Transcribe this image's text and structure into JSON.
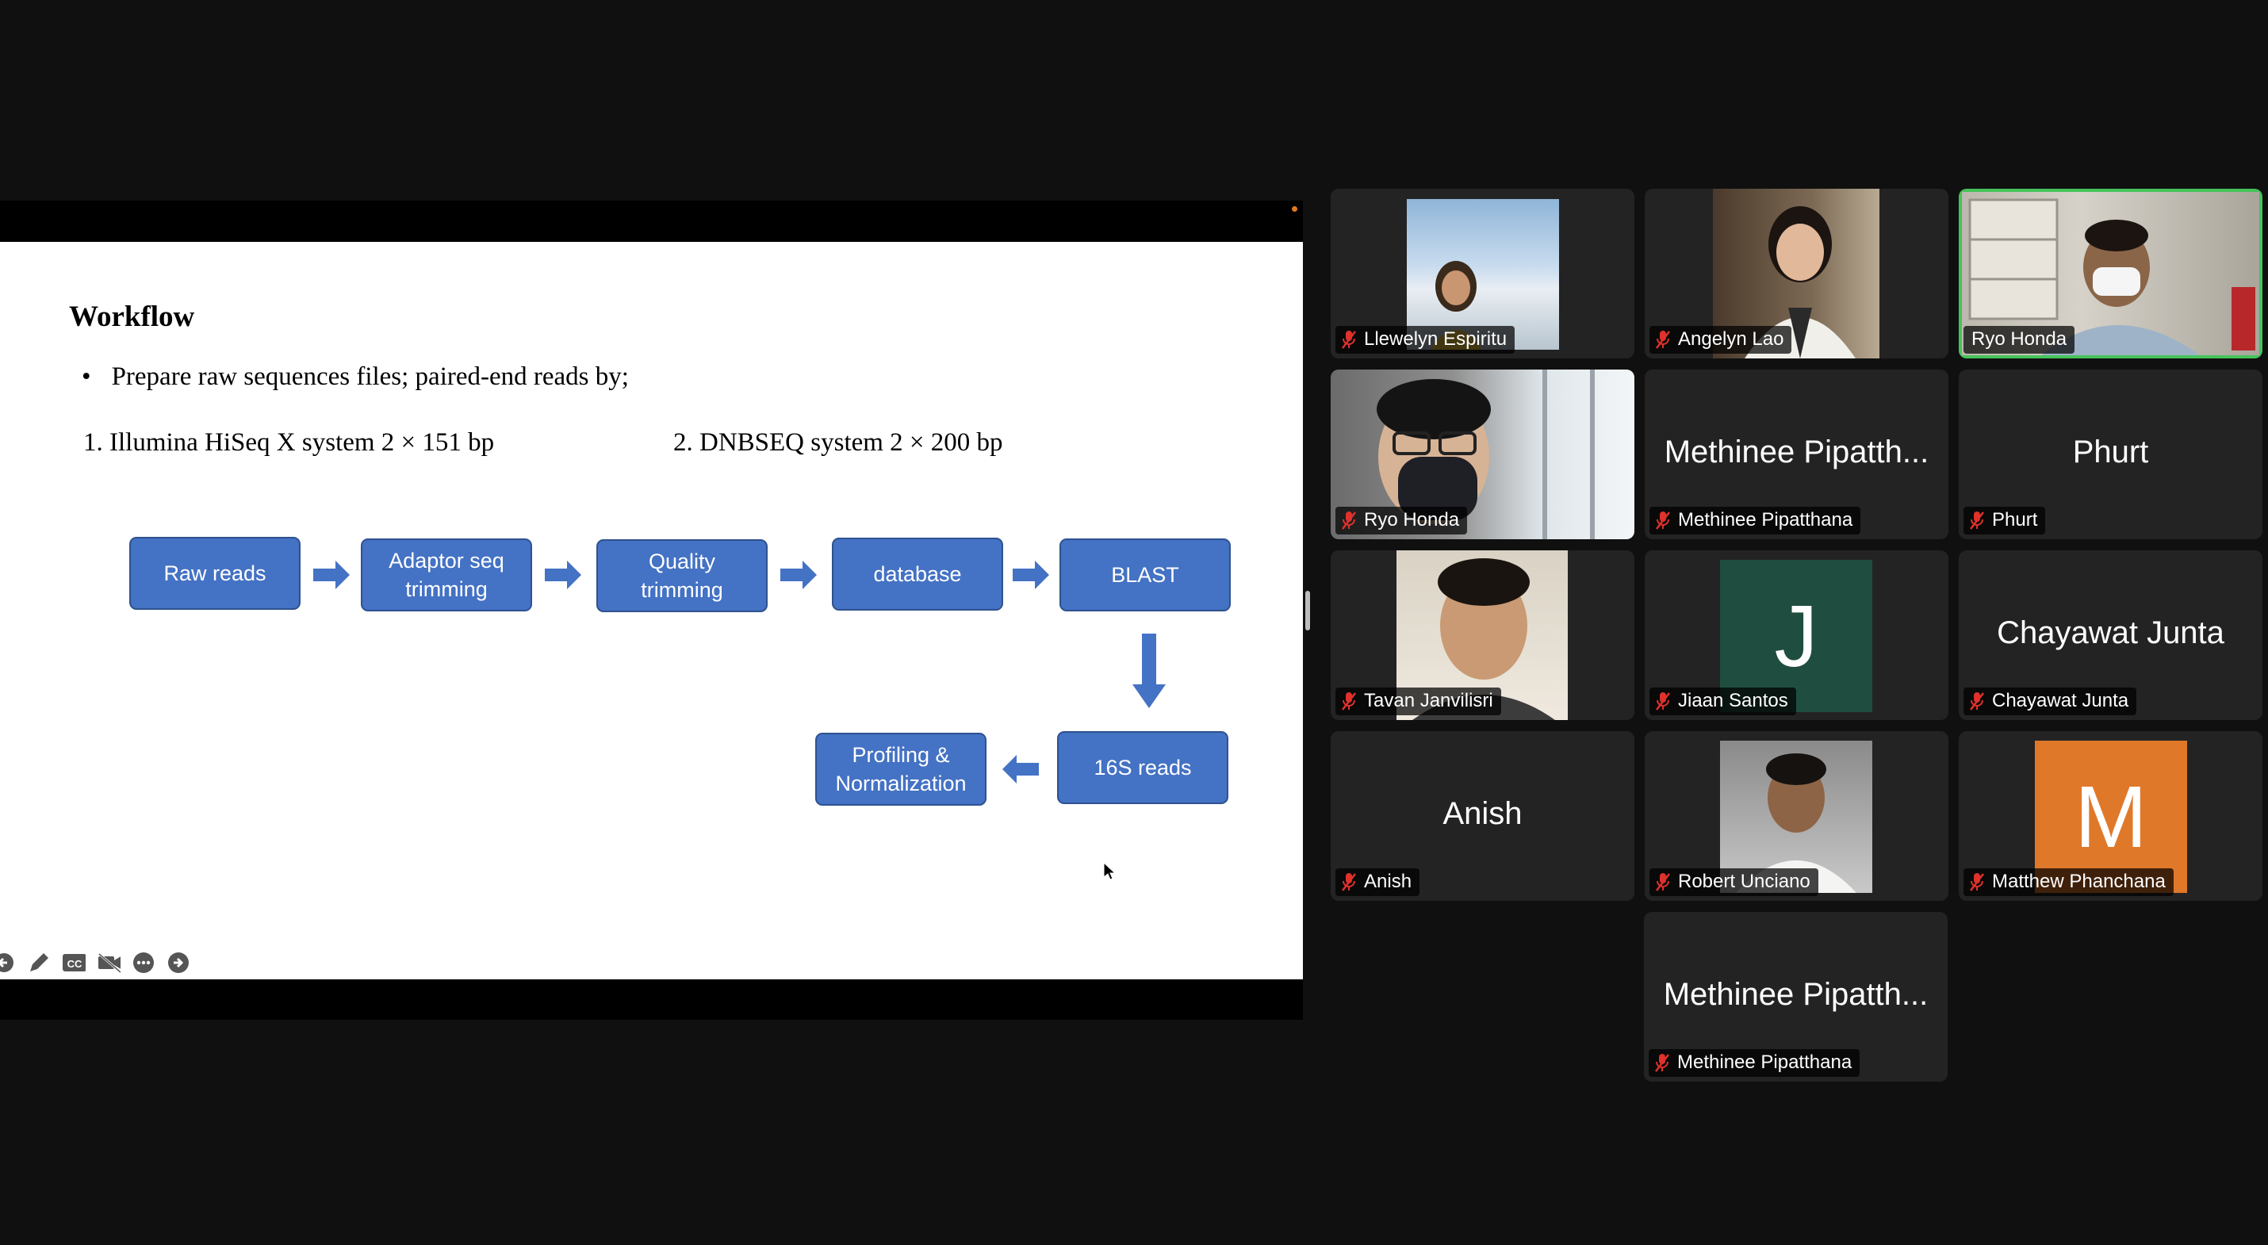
{
  "slide": {
    "title": "Workflow",
    "bullet": "Prepare raw sequences files; paired-end reads by;",
    "item1": "1. Illumina HiSeq X system 2 × 151 bp",
    "item2": "2. DNBSEQ system 2 × 200 bp",
    "flow": {
      "raw_reads": "Raw reads",
      "adaptor_l1": "Adaptor seq",
      "adaptor_l2": "trimming",
      "quality_l1": "Quality",
      "quality_l2": "trimming",
      "database": "database",
      "blast": "BLAST",
      "reads16s": "16S reads",
      "profiling_l1": "Profiling &",
      "profiling_l2": "Normalization"
    },
    "box_color": "#4472c4",
    "toolbar_icons": [
      "arrow-left-icon",
      "pen-icon",
      "captions-icon",
      "video-off-icon",
      "more-icon",
      "arrow-right-icon"
    ]
  },
  "participants": [
    {
      "name": "Llewelyn Espiritu",
      "muted": true,
      "video": "photo"
    },
    {
      "name": "Angelyn Lao",
      "muted": true,
      "video": "photo"
    },
    {
      "name": "Ryo Honda",
      "muted": false,
      "video": "photo",
      "active_speaker": true
    },
    {
      "name": "Ryo Honda",
      "muted": true,
      "video": "photo"
    },
    {
      "name": "Methinee Pipatthana",
      "display": "Methinee Pipatth...",
      "muted": true,
      "video": "off"
    },
    {
      "name": "Phurt",
      "display": "Phurt",
      "muted": true,
      "video": "off"
    },
    {
      "name": "Tavan Janvilisri",
      "muted": true,
      "video": "photo"
    },
    {
      "name": "Jiaan Santos",
      "initial": "J",
      "muted": true,
      "video": "avatar",
      "avatar_color": "#1f4d3f"
    },
    {
      "name": "Chayawat Junta",
      "display": "Chayawat Junta",
      "muted": true,
      "video": "off"
    },
    {
      "name": "Anish",
      "display": "Anish",
      "muted": true,
      "video": "off"
    },
    {
      "name": "Robert Unciano",
      "muted": true,
      "video": "photo"
    },
    {
      "name": "Matthew Phanchana",
      "initial": "M",
      "muted": true,
      "video": "avatar",
      "avatar_color": "#e0782a"
    },
    {
      "name": "Methinee Pipatthana",
      "display": "Methinee Pipatth...",
      "muted": true,
      "video": "off"
    }
  ],
  "colors": {
    "active_speaker_border": "#45c35a",
    "muted_mic": "#e0312b",
    "tile_bg": "#232323"
  }
}
